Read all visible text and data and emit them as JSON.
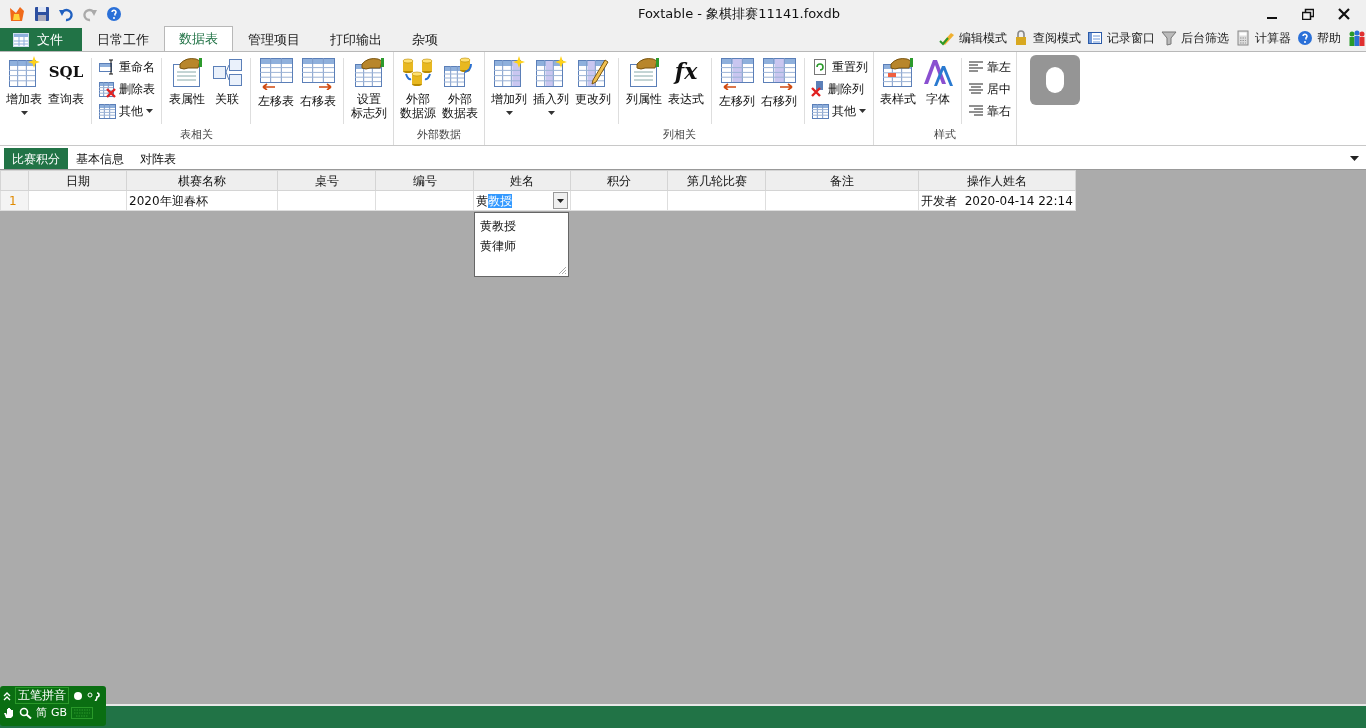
{
  "window": {
    "title": "Foxtable - 象棋排赛11141.foxdb"
  },
  "menu_tabs": [
    {
      "label": "文件",
      "kind": "file",
      "selected": false
    },
    {
      "label": "日常工作",
      "kind": "tab",
      "selected": false
    },
    {
      "label": "数据表",
      "kind": "tab",
      "selected": true
    },
    {
      "label": "管理项目",
      "kind": "tab",
      "selected": false
    },
    {
      "label": "打印输出",
      "kind": "tab",
      "selected": false
    },
    {
      "label": "杂项",
      "kind": "tab",
      "selected": false
    }
  ],
  "toolbar_right": [
    {
      "label": "编辑模式"
    },
    {
      "label": "查阅模式"
    },
    {
      "label": "记录窗口"
    },
    {
      "label": "后台筛选"
    },
    {
      "label": "计算器"
    },
    {
      "label": "帮助"
    }
  ],
  "ribbon_groups": [
    {
      "title": "表相关",
      "items": [
        {
          "kind": "large",
          "label": "增加表",
          "dropdown": true
        },
        {
          "kind": "large",
          "label": "查询表",
          "icon_text": "SQL",
          "dropdown": false
        },
        {
          "kind": "separator"
        },
        {
          "kind": "stack",
          "items": [
            {
              "label": "重命名",
              "dropdown": false
            },
            {
              "label": "删除表",
              "dropdown": false
            },
            {
              "label": "其他",
              "dropdown": true
            }
          ]
        },
        {
          "kind": "separator"
        },
        {
          "kind": "large",
          "label": "表属性",
          "dropdown": false
        },
        {
          "kind": "large",
          "label": "关联",
          "dropdown": false
        },
        {
          "kind": "separator"
        },
        {
          "kind": "large",
          "label": "左移表",
          "dropdown": false
        },
        {
          "kind": "large",
          "label": "右移表",
          "dropdown": false
        },
        {
          "kind": "separator"
        },
        {
          "kind": "large",
          "label_lines": [
            "设置",
            "标志列"
          ],
          "dropdown": false
        }
      ]
    },
    {
      "title": "外部数据",
      "items": [
        {
          "kind": "large",
          "label_lines": [
            "外部",
            "数据源"
          ],
          "dropdown": false
        },
        {
          "kind": "large",
          "label_lines": [
            "外部",
            "数据表"
          ],
          "dropdown": false
        }
      ]
    },
    {
      "title": "列相关",
      "items": [
        {
          "kind": "large",
          "label": "增加列",
          "dropdown": true
        },
        {
          "kind": "large",
          "label": "插入列",
          "dropdown": true
        },
        {
          "kind": "large",
          "label": "更改列",
          "dropdown": false
        },
        {
          "kind": "separator"
        },
        {
          "kind": "large",
          "label": "列属性",
          "dropdown": false
        },
        {
          "kind": "large",
          "label": "表达式",
          "icon_text": "fx",
          "dropdown": false
        },
        {
          "kind": "separator"
        },
        {
          "kind": "large",
          "label": "左移列",
          "dropdown": false
        },
        {
          "kind": "large",
          "label": "右移列",
          "dropdown": false
        },
        {
          "kind": "separator"
        },
        {
          "kind": "stack",
          "items": [
            {
              "label": "重置列",
              "dropdown": false
            },
            {
              "label": "删除列",
              "dropdown": false
            },
            {
              "label": "其他",
              "dropdown": true
            }
          ]
        }
      ]
    },
    {
      "title": "样式",
      "items": [
        {
          "kind": "large",
          "label": "表样式",
          "dropdown": false
        },
        {
          "kind": "large",
          "label": "字体",
          "dropdown": false
        },
        {
          "kind": "separator"
        },
        {
          "kind": "stack",
          "items": [
            {
              "label": "靠左",
              "dropdown": false
            },
            {
              "label": "居中",
              "dropdown": false
            },
            {
              "label": "靠右",
              "dropdown": false
            }
          ]
        }
      ]
    }
  ],
  "sheet_tabs": [
    {
      "label": "比赛积分",
      "selected": true
    },
    {
      "label": "基本信息",
      "selected": false
    },
    {
      "label": "对阵表",
      "selected": false
    }
  ],
  "table": {
    "columns": [
      "日期",
      "棋赛名称",
      "桌号",
      "编号",
      "姓名",
      "积分",
      "第几轮比赛",
      "备注",
      "操作人姓名"
    ],
    "rows": [
      {
        "row_number": "1",
        "cells": [
          null,
          "2020年迎春杯",
          null,
          null,
          {
            "typed": "黄",
            "autocomplete": "教授",
            "editing": true
          },
          null,
          null,
          null,
          "开发者  2020-04-14 22:14"
        ]
      }
    ]
  },
  "dropdown": {
    "options": [
      "黄教授",
      "黄律师"
    ]
  },
  "ime": {
    "mode": "五笔拼音",
    "script": "简",
    "charset": "GB"
  }
}
